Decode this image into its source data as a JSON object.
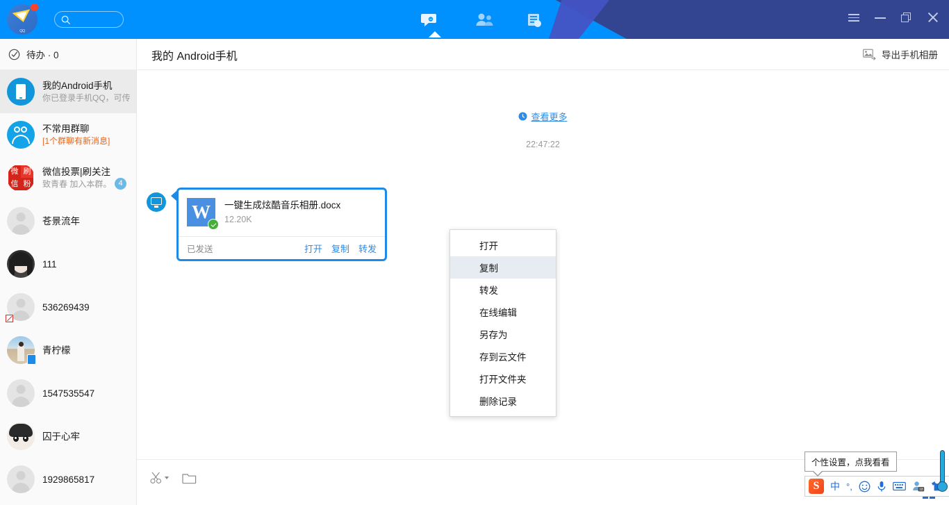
{
  "titlebar": {
    "logo_text": "QQ",
    "search_placeholder": "",
    "tabs": [
      {
        "name": "messages",
        "icon": "chat-bubble-icon",
        "active": true
      },
      {
        "name": "contacts",
        "icon": "contacts-icon",
        "active": false
      },
      {
        "name": "news",
        "icon": "news-document-icon",
        "active": false
      }
    ],
    "window_controls": [
      {
        "name": "menu",
        "icon": "hamburger-menu-icon"
      },
      {
        "name": "minimize",
        "icon": "minimize-icon"
      },
      {
        "name": "maximize",
        "icon": "restore-icon"
      },
      {
        "name": "close",
        "icon": "close-icon"
      }
    ],
    "colors": {
      "primary": "#0091ff",
      "dark_accent": "#334490",
      "mid_accent": "#4453c4"
    }
  },
  "sidebar": {
    "todo": {
      "label": "待办 · 0",
      "icon": "check-circle-icon"
    },
    "contacts": [
      {
        "name": "我的Android手机",
        "sub": "你已登录手机QQ，可传",
        "avatar": "phone-avatar",
        "selected": true,
        "badge": null,
        "sub_color": "gray"
      },
      {
        "name": "不常用群聊",
        "sub": "[1个群聊有新消息]",
        "avatar": "group-avatar",
        "selected": false,
        "badge": null,
        "sub_color": "orange"
      },
      {
        "name": "微信投票|刷关注",
        "sub": "致青春 加入本群。",
        "avatar": "seal-avatar",
        "selected": false,
        "badge": "4",
        "sub_color": "gray"
      },
      {
        "name": "苍景流年",
        "sub": "",
        "avatar": "generic-avatar",
        "selected": false,
        "badge": null,
        "sub_color": "gray"
      },
      {
        "name": "111",
        "sub": "",
        "avatar": "girl-avatar",
        "selected": false,
        "badge": null,
        "sub_color": "gray"
      },
      {
        "name": "536269439",
        "sub": "",
        "avatar": "generic-avatar",
        "selected": false,
        "badge": null,
        "badge_icon": "red-slash-icon",
        "sub_color": "gray"
      },
      {
        "name": "青柠檬",
        "sub": "",
        "avatar": "photo-avatar",
        "selected": false,
        "badge": null,
        "badge_icon": "mobile-online-icon",
        "sub_color": "gray"
      },
      {
        "name": "1547535547",
        "sub": "",
        "avatar": "generic-avatar",
        "selected": false,
        "badge": null,
        "sub_color": "gray"
      },
      {
        "name": "囚于心牢",
        "sub": "",
        "avatar": "boy-avatar",
        "selected": false,
        "badge": null,
        "sub_color": "gray"
      },
      {
        "name": "1929865817",
        "sub": "",
        "avatar": "generic-avatar",
        "selected": false,
        "badge": null,
        "sub_color": "gray"
      }
    ]
  },
  "chat": {
    "title": "我的 Android手机",
    "export_label": "导出手机相册",
    "export_icon": "image-export-icon",
    "view_more": "查看更多",
    "view_more_icon": "clock-icon",
    "timestamp": "22:47:22",
    "message": {
      "avatar_icon": "monitor-icon",
      "file_name": "一键生成炫酷音乐相册.docx",
      "file_size": "12.20K",
      "file_type_letter": "W",
      "status_label": "已发送",
      "actions": [
        "打开",
        "复制",
        "转发"
      ]
    }
  },
  "context_menu": {
    "items": [
      {
        "label": "打开",
        "hover": false
      },
      {
        "label": "复制",
        "hover": true
      },
      {
        "label": "转发",
        "hover": false
      },
      {
        "label": "在线编辑",
        "hover": false
      },
      {
        "label": "另存为",
        "hover": false
      },
      {
        "label": "存到云文件",
        "hover": false
      },
      {
        "label": "打开文件夹",
        "hover": false
      },
      {
        "label": "删除记录",
        "hover": false
      }
    ]
  },
  "input_toolbar": {
    "tools": [
      {
        "name": "screenshot-tool",
        "icon": "scissors-icon",
        "has_caret": true
      },
      {
        "name": "file-tool",
        "icon": "folder-icon",
        "has_caret": false
      }
    ]
  },
  "ime": {
    "tooltip": "个性设置，点我看看",
    "items": [
      {
        "name": "sogou-logo",
        "icon": "sogou-s-icon",
        "label": "S"
      },
      {
        "name": "language-mode",
        "icon": "chinese-mode-icon",
        "label": "中"
      },
      {
        "name": "punctuation-mode",
        "icon": "punctuation-icon",
        "label": "°,"
      },
      {
        "name": "emoji",
        "icon": "smiley-icon",
        "label": "☺"
      },
      {
        "name": "voice-input",
        "icon": "microphone-icon",
        "label": ""
      },
      {
        "name": "soft-keyboard",
        "icon": "keyboard-icon",
        "label": ""
      },
      {
        "name": "user-box",
        "icon": "user-badge-icon",
        "label": "18"
      },
      {
        "name": "skins",
        "icon": "tshirt-icon",
        "label": ""
      },
      {
        "name": "toolbox",
        "icon": "grid-apps-icon",
        "label": ""
      }
    ],
    "thermometer_icon": "thermometer-icon"
  }
}
